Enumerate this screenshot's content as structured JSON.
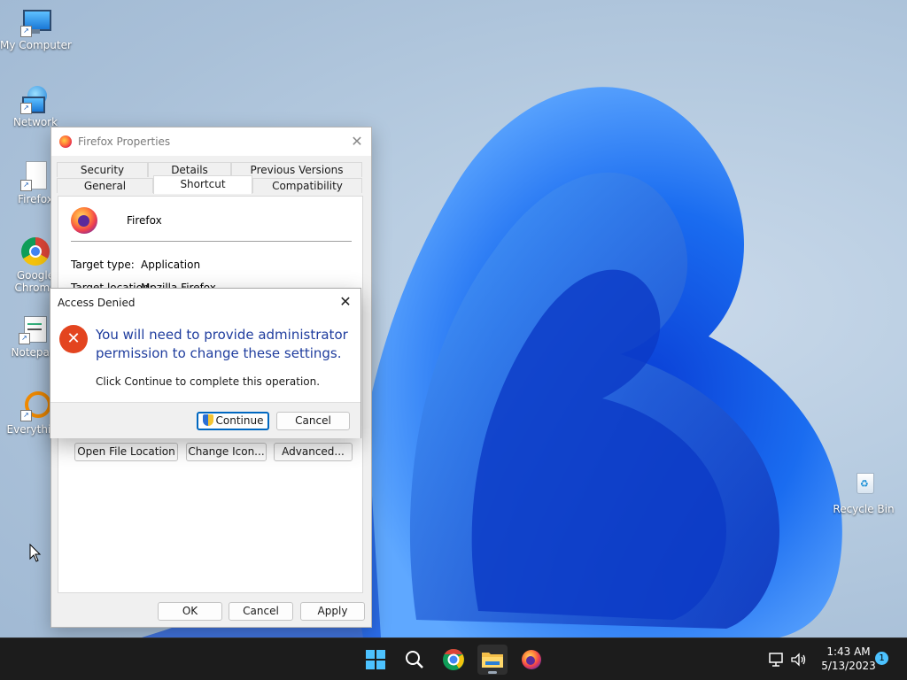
{
  "desktop": {
    "icons": [
      {
        "label": "My Computer"
      },
      {
        "label": "Network"
      },
      {
        "label": "Firefox"
      },
      {
        "label": "Google Chrome",
        "label_line1": "Google",
        "label_line2": "Chrome"
      },
      {
        "label": "Notepad"
      },
      {
        "label": "Everything"
      },
      {
        "label": "Recycle Bin"
      }
    ]
  },
  "properties_window": {
    "title": "Firefox Properties",
    "tabs_row1": [
      "Security",
      "Details",
      "Previous Versions"
    ],
    "tabs_row2": [
      "General",
      "Shortcut",
      "Compatibility"
    ],
    "active_tab": "Shortcut",
    "app_name": "Firefox",
    "target_type_label": "Target type:",
    "target_type_value": "Application",
    "target_location_label": "Target location:",
    "target_location_value": "Mozilla Firefox",
    "buttons": {
      "open_file_location": "Open File Location",
      "change_icon": "Change Icon...",
      "advanced": "Advanced...",
      "ok": "OK",
      "cancel": "Cancel",
      "apply": "Apply"
    }
  },
  "access_denied_dialog": {
    "title": "Access Denied",
    "heading": "You will need to provide administrator permission to change these settings.",
    "message": "Click Continue to complete this operation.",
    "continue_label": "Continue",
    "cancel_label": "Cancel"
  },
  "taskbar": {
    "pinned": [
      "windows-start",
      "search",
      "chrome",
      "file-explorer",
      "firefox"
    ],
    "active_app": "file-explorer",
    "clock_time": "1:43 AM",
    "clock_date": "5/13/2023",
    "notification_count": "1"
  },
  "colors": {
    "accent": "#0067c0",
    "dialog_heading": "#1f3d9e",
    "error_red": "#e3441f",
    "taskbar_bg": "#1c1c1c"
  }
}
